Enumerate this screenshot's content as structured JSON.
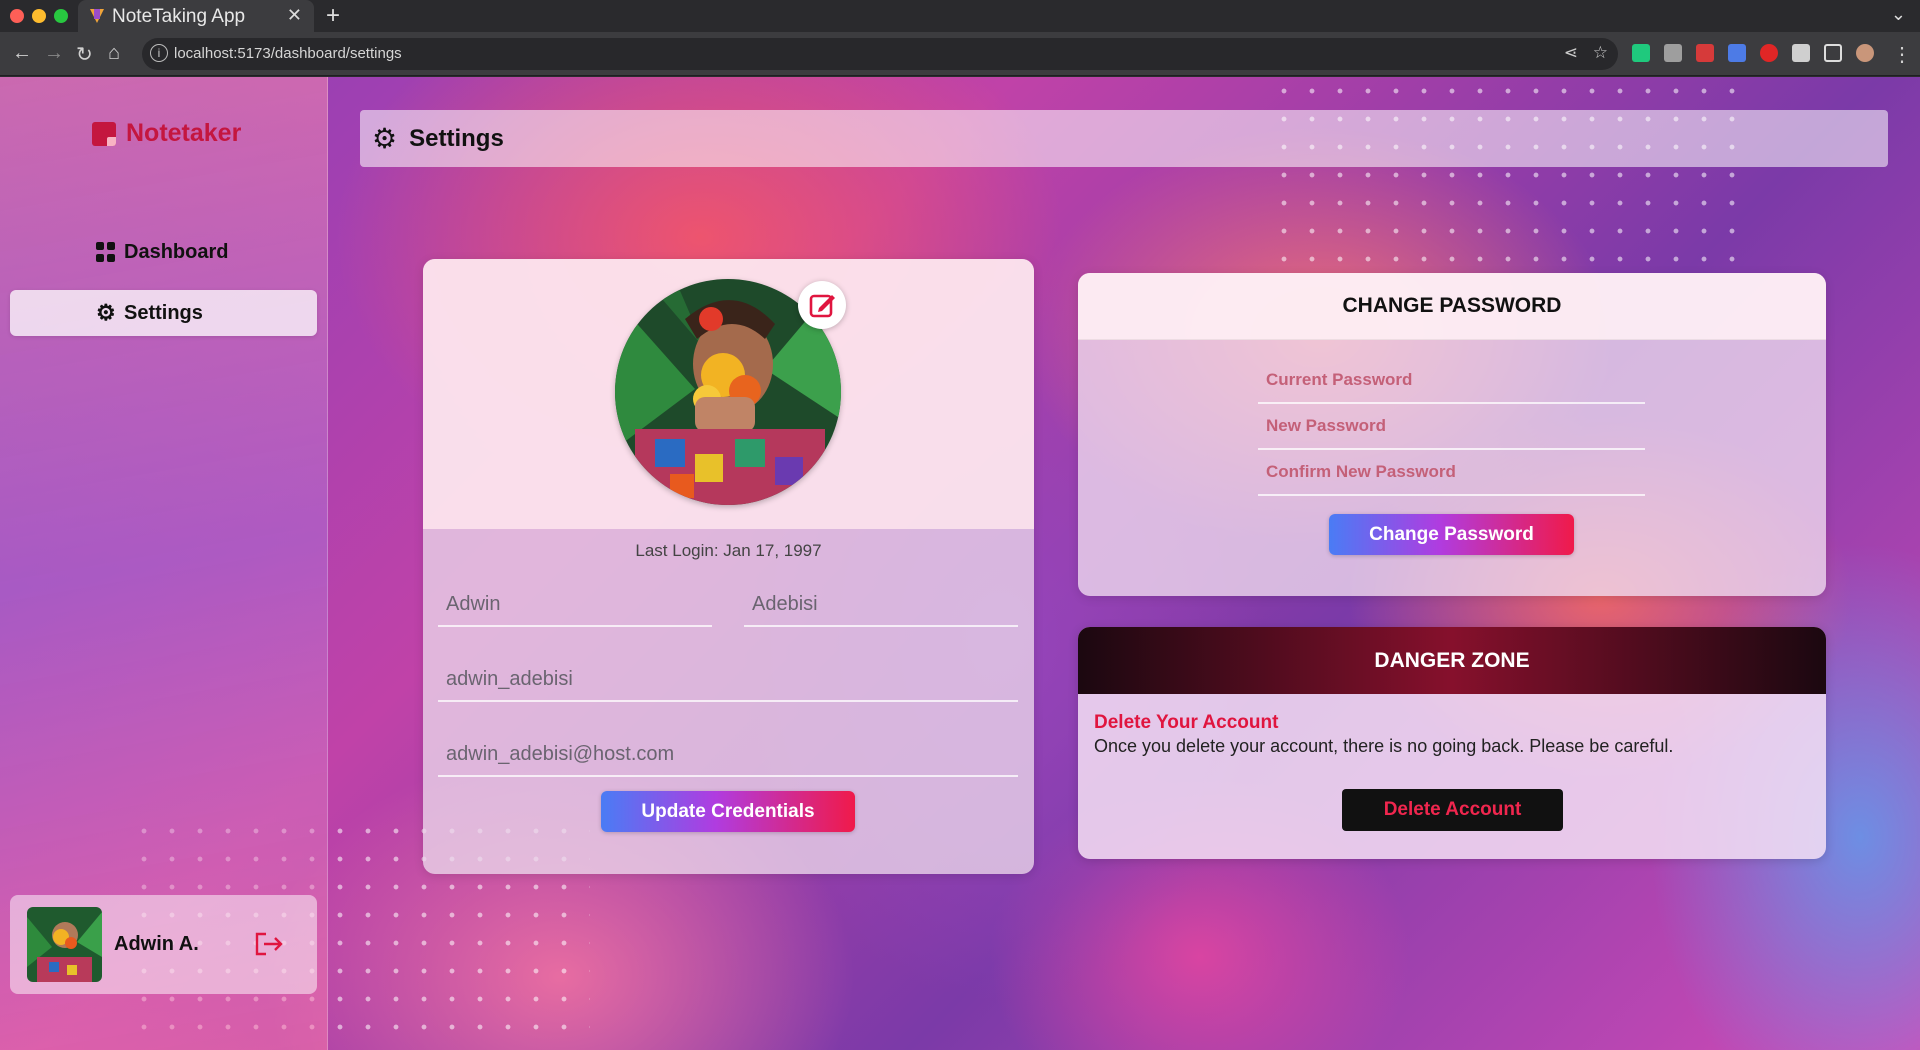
{
  "browser": {
    "tab_title": "NoteTaking App",
    "url": "localhost:5173/dashboard/settings"
  },
  "sidebar": {
    "brand": "Notetaker",
    "items": [
      {
        "label": "Dashboard",
        "icon": "dashboard-grid-icon",
        "active": false
      },
      {
        "label": "Settings",
        "icon": "gear-icon",
        "active": true
      }
    ],
    "user": {
      "name": "Adwin A.",
      "logout_icon": "logout-icon"
    }
  },
  "header": {
    "title": "Settings",
    "icon": "gear-icon"
  },
  "profile": {
    "last_login": "Last Login: Jan 17, 1997",
    "first_name": "Adwin",
    "last_name": "Adebisi",
    "username": "adwin_adebisi",
    "email": "adwin_adebisi@host.com",
    "update_button": "Update Credentials"
  },
  "change_password": {
    "title": "CHANGE PASSWORD",
    "current_placeholder": "Current Password",
    "new_placeholder": "New Password",
    "confirm_placeholder": "Confirm New Password",
    "button": "Change Password"
  },
  "danger_zone": {
    "title": "DANGER ZONE",
    "heading": "Delete Your Account",
    "description": "Once you delete your account, there is no going back. Please be careful.",
    "button": "Delete Account"
  },
  "colors": {
    "brand": "#c4163f",
    "danger_red": "#e0153f",
    "button_gradient": [
      "#4a7cf5",
      "#b03ce0",
      "#f01a4a"
    ]
  }
}
